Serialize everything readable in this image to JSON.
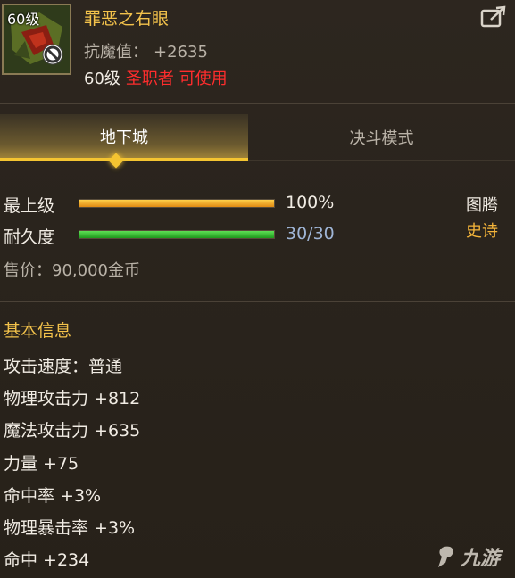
{
  "item": {
    "level_tag": "60级",
    "name": "罪恶之右眼",
    "resist_label": "抗魔值：",
    "resist_value": "+2635",
    "req_level": "60级",
    "req_class": "圣职者 可使用"
  },
  "tabs": [
    {
      "label": "地下城",
      "active": true
    },
    {
      "label": "决斗模式",
      "active": false
    }
  ],
  "grade": {
    "label": "最上级",
    "percent": 100,
    "percent_text": "100%"
  },
  "durability": {
    "label": "耐久度",
    "current": 30,
    "max": 30,
    "text": "30/30"
  },
  "item_type": {
    "category": "图腾",
    "rarity": "史诗",
    "rarity_color": "#f4b43a"
  },
  "price": "售价：90,000金币",
  "basic_info": {
    "title": "基本信息",
    "stats": [
      "攻击速度：普通",
      "物理攻击力 +812",
      "魔法攻击力 +635",
      "力量 +75",
      "命中率 +3%",
      "物理暴击率 +3%",
      "命中 +234"
    ]
  },
  "watermark": "九游",
  "colors": {
    "name": "#f3c24b",
    "class_req": "#ff2d2d",
    "grade_bar": "#f0a21c",
    "durability_bar": "#2dbb2a",
    "tab_active_border": "#f4c431"
  }
}
